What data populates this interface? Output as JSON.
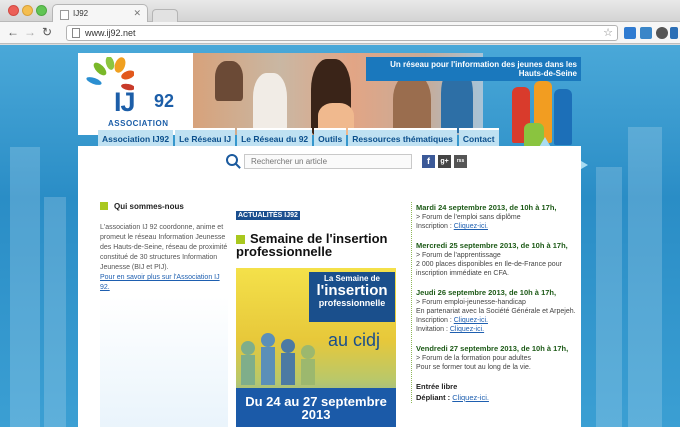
{
  "browser": {
    "tab_title": "IJ92",
    "url": "www.ij92.net"
  },
  "header": {
    "logo_ij": "IJ",
    "logo_92": "92",
    "logo_association": "ASSOCIATION",
    "tagline": "Un réseau pour l'information des jeunes dans les Hauts-de-Seine"
  },
  "nav": {
    "items": [
      {
        "label": "Association IJ92"
      },
      {
        "label": "Le Réseau IJ"
      },
      {
        "label": "Le Réseau du 92"
      },
      {
        "label": "Outils"
      },
      {
        "label": "Ressources thématiques"
      },
      {
        "label": "Contact"
      }
    ]
  },
  "search": {
    "placeholder": "Rechercher un article"
  },
  "social": {
    "facebook": "f",
    "googleplus": "g+",
    "rss": "rss"
  },
  "about": {
    "title": "Qui sommes-nous",
    "body": "L'association IJ 92 coordonne, anime et promeut le réseau Information Jeunesse des Hauts-de-Seine, réseau de proximité constitué de 30 structures Information Jeunesse (BIJ et PIJ).",
    "link": "Pour en savoir plus sur l'Association IJ 92."
  },
  "news": {
    "tag": "ACTUALITÉS IJ92",
    "title": "Semaine de l'insertion professionnelle",
    "poster": {
      "line1": "La Semaine de",
      "line2": "l'insertion",
      "line3": "professionnelle",
      "cidj": "au cidj",
      "dates": "Du 24 au 27 septembre 2013"
    }
  },
  "events": [
    {
      "date": "Mardi 24 septembre 2013, de 10h à 17h,",
      "lines": [
        "> Forum de l'emploi sans diplôme"
      ],
      "inscription_label": "Inscription : ",
      "inscription_link": "Cliquez-ici."
    },
    {
      "date": "Mercredi 25 septembre 2013, de 10h à 17h,",
      "lines": [
        "> Forum de l'apprentissage",
        "2 000 places disponibles en Ile-de-France pour inscription immédiate en CFA."
      ]
    },
    {
      "date": "Jeudi 26 septembre 2013, de 10h à 17h,",
      "lines": [
        "> Forum emploi-jeunesse-handicap",
        "En partenariat avec la Société Générale et Arpejeh."
      ],
      "inscription_label": "Inscription : ",
      "inscription_link": "Cliquez-ici.",
      "invitation_label": "Invitation : ",
      "invitation_link": "Cliquez-ici."
    },
    {
      "date": "Vendredi 27 septembre 2013, de 10h à 17h,",
      "lines": [
        "> Forum de la formation pour adultes",
        "Pour se former tout au long de la vie."
      ]
    }
  ],
  "entry": {
    "free": "Entrée libre",
    "leaflet_label": "Dépliant : ",
    "leaflet_link": "Cliquez-ici."
  },
  "colors": {
    "brand_blue": "#1c5ea8",
    "accent_green": "#a9c81f",
    "date_green": "#1d5a17"
  }
}
